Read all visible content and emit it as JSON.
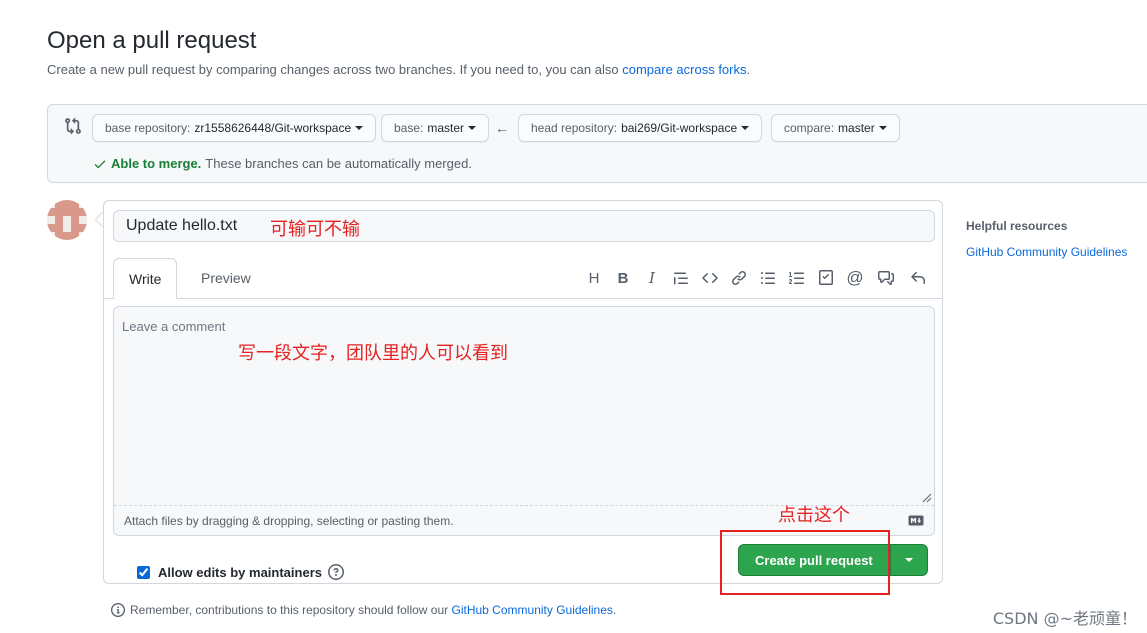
{
  "header": {
    "title": "Open a pull request",
    "subtitle_text": "Create a new pull request by comparing changes across two branches. If you need to, you can also",
    "subtitle_link": "compare across forks",
    "subtitle_end": "."
  },
  "range": {
    "base_repo_label": "base repository:",
    "base_repo_value": "zr1558626448/Git-workspace",
    "base_label": "base:",
    "base_value": "master",
    "head_repo_label": "head repository:",
    "head_repo_value": "bai269/Git-workspace",
    "compare_label": "compare:",
    "compare_value": "master",
    "merge_ok": "Able to merge.",
    "merge_text": "These branches can be automatically merged."
  },
  "form": {
    "title_value": "Update hello.txt",
    "title_annotation": "可输可不输",
    "tabs": [
      "Write",
      "Preview"
    ],
    "comment_placeholder": "Leave a comment",
    "comment_annotation": "写一段文字，团队里的人可以看到",
    "attach_text": "Attach files by dragging & dropping, selecting or pasting them.",
    "allow_edits_label": "Allow edits by maintainers",
    "allow_edits_checked": true,
    "create_button": "Create pull request",
    "button_annotation": "点击这个"
  },
  "toolbar_icons": [
    "heading-icon",
    "bold-icon",
    "italic-icon",
    "quote-icon",
    "code-icon",
    "link-icon",
    "bulleted-list-icon",
    "numbered-list-icon",
    "task-list-icon",
    "mention-icon",
    "reference-icon",
    "reply-icon"
  ],
  "sidebar": {
    "title": "Helpful resources",
    "link": "GitHub Community Guidelines"
  },
  "footer": {
    "text": "Remember, contributions to this repository should follow our",
    "link": "GitHub Community Guidelines",
    "end": "."
  },
  "watermark": "CSDN @~老顽童！",
  "colors": {
    "primary_green": "#2da44e",
    "link_blue": "#0969da",
    "success_green": "#1a7f37",
    "annotation_red": "#e52222"
  }
}
